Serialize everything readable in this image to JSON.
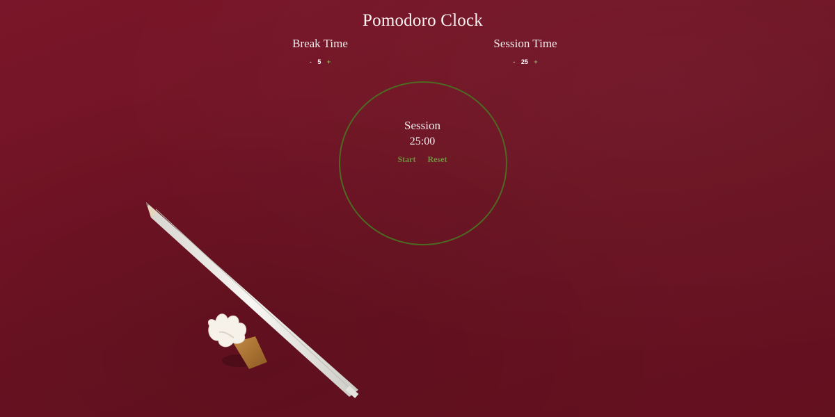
{
  "app": {
    "title": "Pomodoro Clock"
  },
  "break_setting": {
    "label": "Break Time",
    "decrement_label": "-",
    "value": "5",
    "increment_label": "+"
  },
  "session_setting": {
    "label": "Session Time",
    "decrement_label": "-",
    "value": "25",
    "increment_label": "+"
  },
  "timer": {
    "label": "Session",
    "display": "25:00",
    "start_label": "Start",
    "reset_label": "Reset"
  },
  "colors": {
    "background": "#6b1222",
    "circle_border": "#4d6a22",
    "action_text": "#6f8f3e"
  },
  "icons": {
    "background_objects": [
      "pencil-icon",
      "ice-cream-eraser-icon"
    ]
  }
}
